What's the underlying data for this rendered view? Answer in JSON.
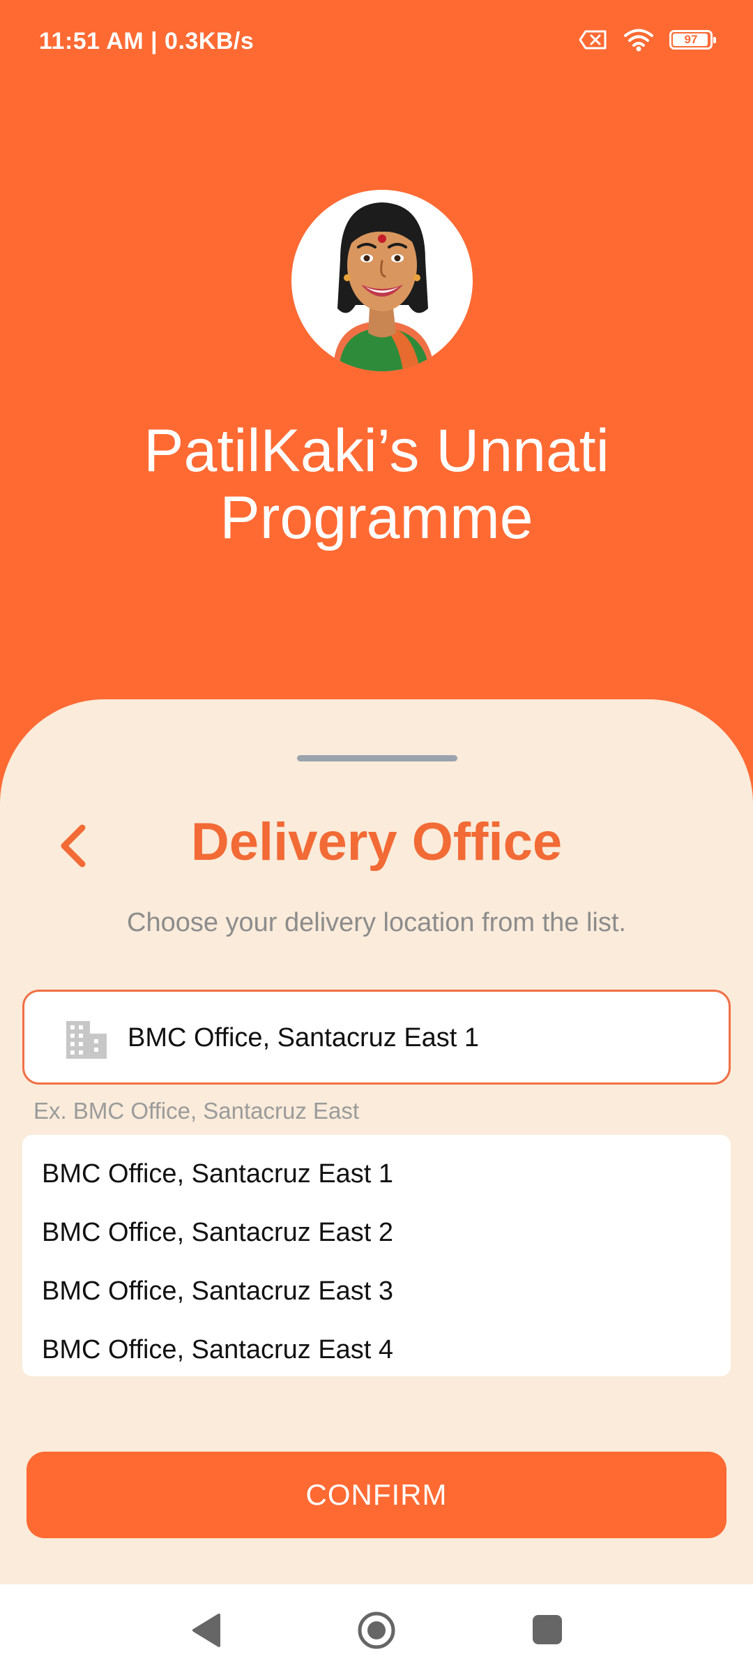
{
  "status_bar": {
    "time_speed": "11:51 AM | 0.3KB/s",
    "battery_level": "97",
    "battery_fraction": 0.97,
    "icons": [
      "sim-no-signal-icon",
      "wifi-icon",
      "battery-icon"
    ]
  },
  "header": {
    "avatar": "woman-avatar-illustration",
    "title_line1": "PatilKaki’s Unnati",
    "title_line2": "Programme"
  },
  "sheet": {
    "title": "Delivery Office",
    "subtitle": "Choose your delivery location from the list.",
    "back_icon": "chevron-left-icon"
  },
  "search": {
    "icon": "building-icon",
    "value": "BMC Office, Santacruz East 1",
    "helper": "Ex. BMC Office, Santacruz East"
  },
  "suggestions": [
    "BMC Office, Santacruz East 1",
    "BMC Office, Santacruz East 2",
    "BMC Office, Santacruz East 3",
    "BMC Office, Santacruz East 4"
  ],
  "confirm_label": "CONFIRM",
  "colors": {
    "brand_orange": "#FF6A33",
    "title_orange": "#F26A35",
    "sheet_bg": "#FAEBDA",
    "text_dark": "#111111",
    "text_muted": "#8C8C8C"
  },
  "nav_bar": {
    "icons": [
      "back-triangle-icon",
      "home-circle-icon",
      "recents-square-icon"
    ]
  }
}
